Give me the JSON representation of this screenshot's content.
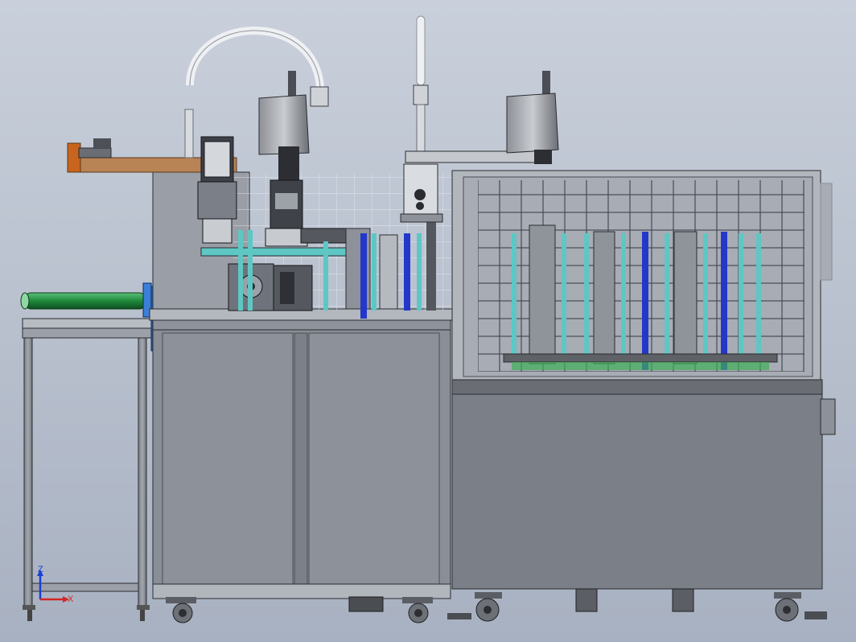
{
  "colors": {
    "bg_top": "#c7ced9",
    "bg_bottom": "#a9b2c2",
    "panel": "#8b8f98",
    "panel_light": "#a7abb3",
    "frame": "#5f636b",
    "edge": "#2a2c30",
    "cyan": "#5ec7c4",
    "blue": "#2437c9",
    "green": "#1f8a3c",
    "motor_blue": "#2f6fc7",
    "wood": "#b88355",
    "orange": "#c7641e",
    "axis_x": "#d22626",
    "axis_y": "#1a3fd6"
  },
  "icons": {
    "triad": "coordinate-triad-icon"
  },
  "triad": {
    "x_label": "X",
    "z_label": "Z"
  }
}
